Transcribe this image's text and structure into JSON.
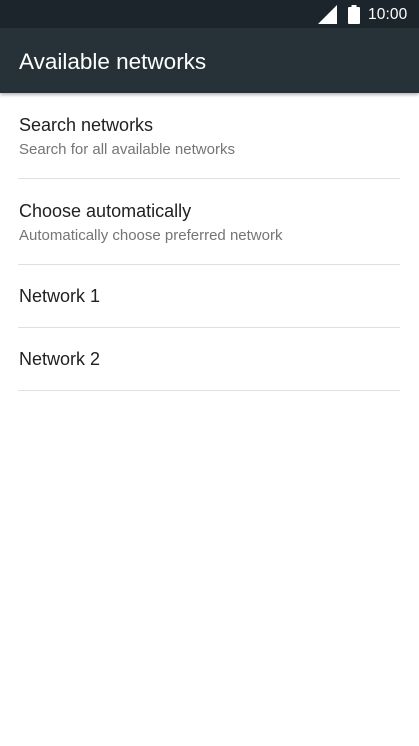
{
  "status_bar": {
    "time": "10:00",
    "signal_icon": "cellular-signal-full-icon",
    "battery_icon": "battery-full-icon"
  },
  "app_bar": {
    "title": "Available networks"
  },
  "preferences": [
    {
      "title": "Search networks",
      "summary": "Search for all available networks"
    },
    {
      "title": "Choose automatically",
      "summary": "Automatically choose preferred network"
    },
    {
      "title": "Network 1"
    },
    {
      "title": "Network 2"
    }
  ],
  "colors": {
    "status_bar_bg": "#1b252b",
    "app_bar_bg": "#263238",
    "primary_text": "#212121",
    "secondary_text": "#757575",
    "divider": "#e0e0e0"
  }
}
